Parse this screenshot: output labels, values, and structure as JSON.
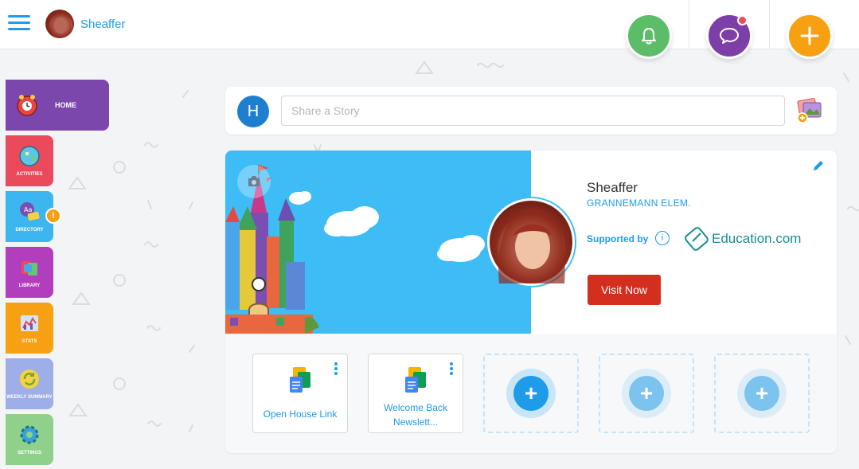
{
  "header": {
    "user_name": "Sheaffer",
    "actions": [
      {
        "name": "notifications",
        "icon": "bell-icon",
        "color": "#5cbd69"
      },
      {
        "name": "messages",
        "icon": "chat-bubble-icon",
        "color": "#7d3ea8",
        "has_unread": true
      },
      {
        "name": "create",
        "icon": "plus-icon",
        "color": "#f7a012"
      }
    ]
  },
  "sidebar": {
    "items": [
      {
        "label": "HOME",
        "color": "#7b47ad",
        "icon": "school-bell-icon",
        "active": true
      },
      {
        "label": "ACTIVITIES",
        "color": "#ea4a5b",
        "icon": "globe-icon"
      },
      {
        "label": "DIRECTORY",
        "color": "#3db6ef",
        "icon": "people-icon",
        "badge": "!"
      },
      {
        "label": "LIBRARY",
        "color": "#b23dbd",
        "icon": "books-icon"
      },
      {
        "label": "STATS",
        "color": "#f7a012",
        "icon": "chart-icon"
      },
      {
        "label": "WEEKLY SUMMARY",
        "color": "#9eaee6",
        "icon": "refresh-icon"
      },
      {
        "label": "SETTINGS",
        "color": "#8fd18b",
        "icon": "gear-icon"
      }
    ]
  },
  "story": {
    "avatar_letter": "H",
    "placeholder": "Share a Story"
  },
  "profile": {
    "name": "Sheaffer",
    "school": "GRANNEMANN ELEM.",
    "supported_by_label": "Supported by",
    "sponsor": "Education.com",
    "visit_button": "Visit Now"
  },
  "links": [
    {
      "title": "Open House Link",
      "icon": "google-docs-icon"
    },
    {
      "title": "Welcome Back Newslett...",
      "icon": "google-docs-icon"
    }
  ],
  "add_slots": 3,
  "colors": {
    "accent": "#1e9be9",
    "banner_sky": "#3dbcf6",
    "visit_red": "#d42e1f"
  }
}
